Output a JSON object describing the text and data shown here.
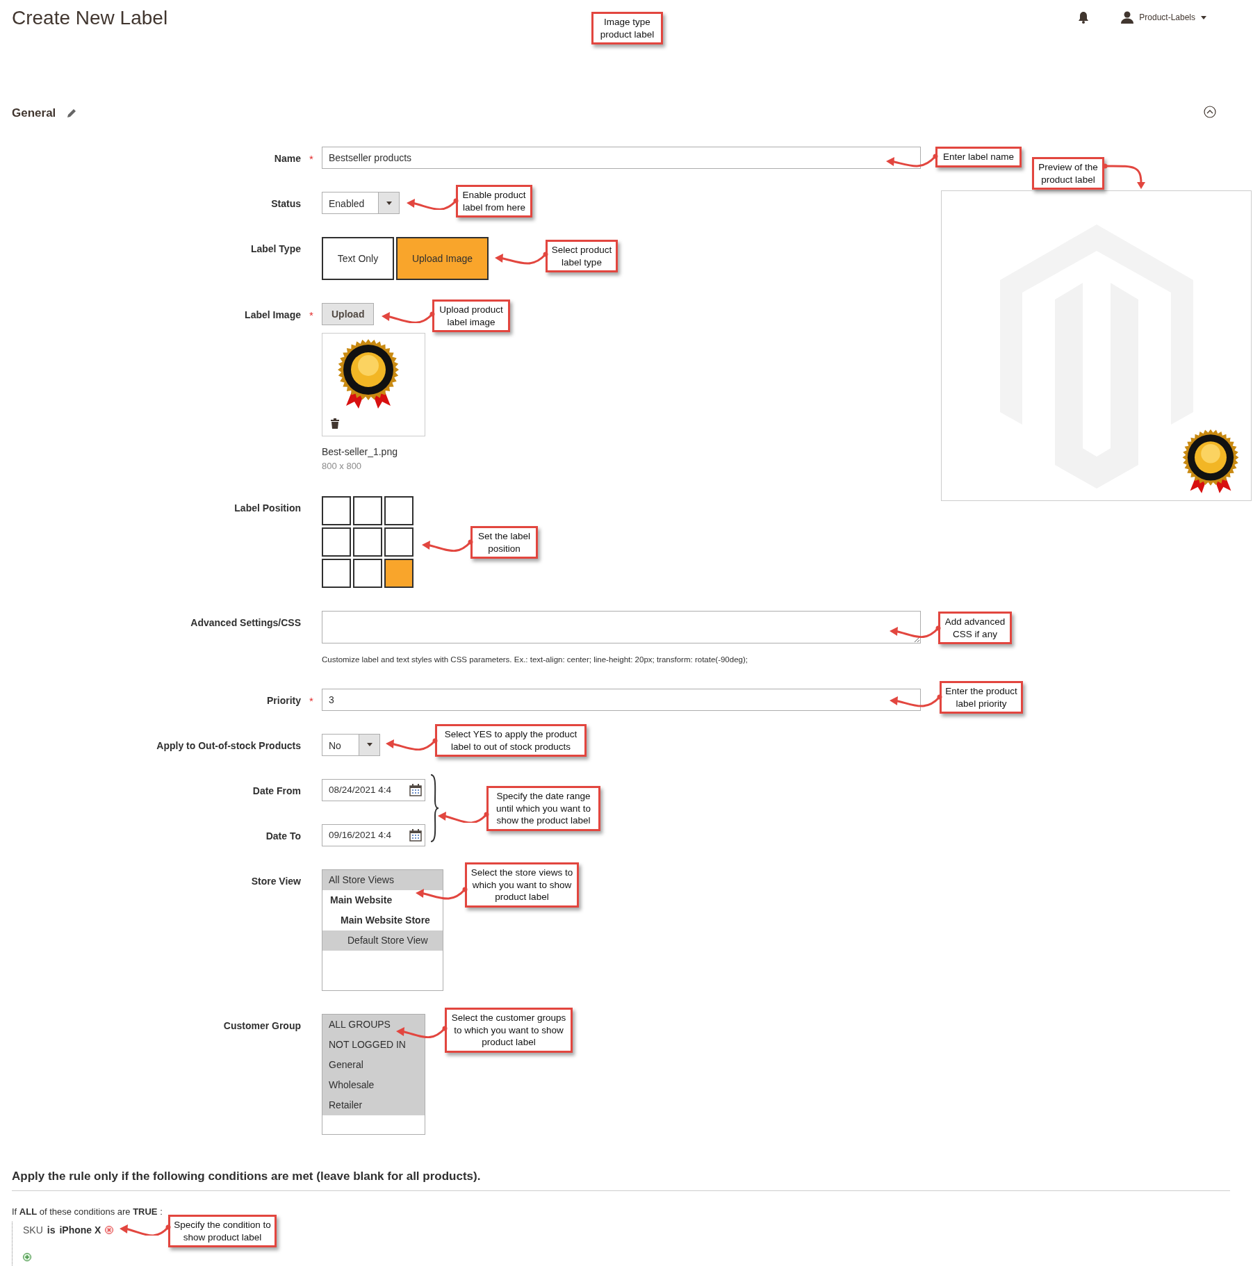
{
  "header": {
    "title": "Create New Label",
    "user": "Product-Labels"
  },
  "section": {
    "title": "General"
  },
  "fields": [
    {
      "kind": "text",
      "label": "Name",
      "required_mark": "*",
      "value": "Bestseller products"
    },
    {
      "kind": "select",
      "label": "Status",
      "value": "Enabled"
    },
    {
      "kind": "toggle",
      "label": "Label Type",
      "options": [
        {
          "label": "Text Only",
          "selected": false
        },
        {
          "label": "Upload Image",
          "selected": true
        }
      ]
    },
    {
      "kind": "image",
      "label": "Label Image",
      "required_mark": "*",
      "button": "Upload",
      "file_name": "Best-seller_1.png",
      "dimensions": "800 x 800"
    },
    {
      "kind": "position",
      "label": "Label Position",
      "cells": [
        {
          "selected": false
        },
        {
          "selected": false
        },
        {
          "selected": false
        },
        {
          "selected": false
        },
        {
          "selected": false
        },
        {
          "selected": false
        },
        {
          "selected": false
        },
        {
          "selected": false
        },
        {
          "selected": true
        }
      ]
    },
    {
      "kind": "textarea",
      "label": "Advanced Settings/CSS",
      "note": "Customize label and text styles with CSS parameters. Ex.: text-align: center; line-height: 20px; transform: rotate(-90deg);"
    },
    {
      "kind": "text",
      "label": "Priority",
      "required_mark": "*",
      "value": "3"
    },
    {
      "kind": "select",
      "label": "Apply to Out-of-stock Products",
      "value": "No"
    },
    {
      "kind": "date",
      "label": "Date From",
      "value": "08/24/2021 4:4"
    },
    {
      "kind": "date",
      "label": "Date To",
      "value": "09/16/2021 4:4"
    },
    {
      "kind": "multiselect",
      "label": "Store View",
      "options": [
        {
          "kind": "plain",
          "label": "All Store Views",
          "selected": true
        },
        {
          "kind": "group",
          "label": "Main Website",
          "selected": false
        },
        {
          "kind": "subgroup",
          "label": "Main Website Store",
          "selected": false
        },
        {
          "kind": "option",
          "label": "Default Store View",
          "selected": true
        }
      ]
    },
    {
      "kind": "multiselect",
      "label": "Customer Group",
      "options": [
        {
          "kind": "plain",
          "label": "ALL GROUPS",
          "selected": true
        },
        {
          "kind": "plain",
          "label": "NOT LOGGED IN",
          "selected": true
        },
        {
          "kind": "plain",
          "label": "General",
          "selected": true
        },
        {
          "kind": "plain",
          "label": "Wholesale",
          "selected": true
        },
        {
          "kind": "plain",
          "label": "Retailer",
          "selected": true
        }
      ]
    }
  ],
  "conditions": {
    "heading": "Apply the rule only if the following conditions are met (leave blank for all products).",
    "intro": "If **ALL**  of these conditions are **TRUE** :",
    "rules": [
      {
        "attribute": "SKU",
        "operator": "is",
        "value": "iPhone X"
      }
    ]
  },
  "annotations": [
    {
      "text": "Image type product label"
    },
    {
      "text": "Enter label name"
    },
    {
      "text": "Preview of the product label"
    },
    {
      "text": "Enable product label from here"
    },
    {
      "text": "Select product label type"
    },
    {
      "text": "Upload product label image"
    },
    {
      "text": "Set the label position"
    },
    {
      "text": "Add advanced CSS if any"
    },
    {
      "text": "Enter the product label priority"
    },
    {
      "text": "Select YES to apply the product label to out of stock products"
    },
    {
      "text": "Specify the date range until which you want to show the product label"
    },
    {
      "text": "Select the store views to which you want to show product label"
    },
    {
      "text": "Select the customer groups to which you want to show product label"
    },
    {
      "text": "Specify the condition to show product label"
    }
  ]
}
